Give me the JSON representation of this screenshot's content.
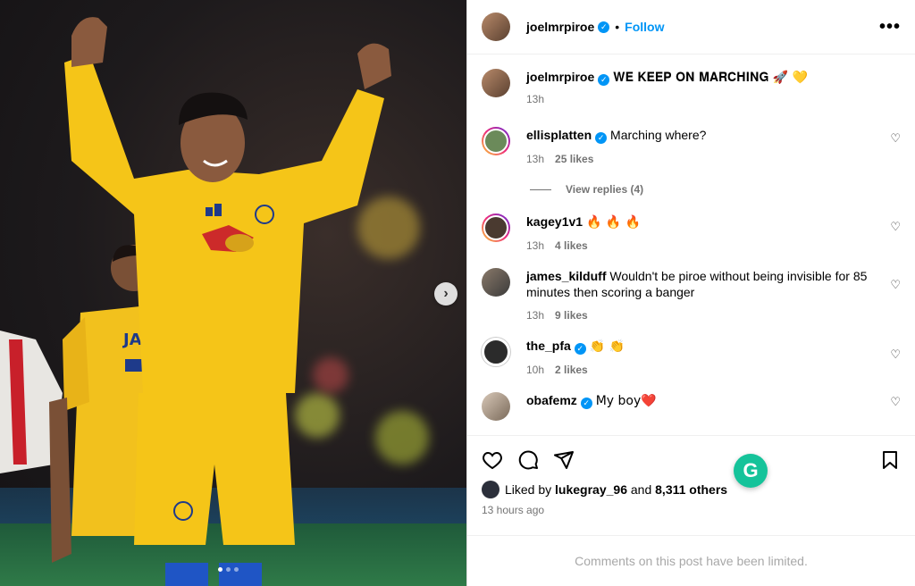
{
  "post": {
    "author": "joelmrpiroe",
    "follow_label": "Follow",
    "separator": "•",
    "more_label": "•••"
  },
  "comments": [
    {
      "user": "joelmrpiroe",
      "verified": true,
      "text": "𝐖𝐄 𝐊𝐄𝐄𝐏 𝐎𝐍 𝐌𝐀𝐑𝐂𝐇𝐈𝐍𝐆 🚀 💛",
      "time": "13h",
      "likes": ""
    },
    {
      "user": "ellisplatten",
      "verified": true,
      "text": "Marching where?",
      "time": "13h",
      "likes": "25 likes"
    },
    {
      "user": "kagey1v1",
      "verified": false,
      "text": "🔥 🔥 🔥",
      "time": "13h",
      "likes": "4 likes"
    },
    {
      "user": "james_kilduff",
      "verified": false,
      "text": "Wouldn't be piroe without being invisible for 85 minutes then scoring a banger",
      "time": "13h",
      "likes": "9 likes"
    },
    {
      "user": "the_pfa",
      "verified": true,
      "text": "👏 👏",
      "time": "10h",
      "likes": "2 likes"
    },
    {
      "user": "obafemz",
      "verified": true,
      "text": "My boy❤️",
      "time": "",
      "likes": ""
    }
  ],
  "view_replies": "View replies (4)",
  "liked_by": {
    "prefix": "Liked by",
    "user": "lukegray_96",
    "and": "and",
    "others": "8,311 others"
  },
  "posted_time": "13 hours ago",
  "limited_text": "Comments on this post have been limited.",
  "grammarly_label": "G",
  "carousel_next": "›"
}
